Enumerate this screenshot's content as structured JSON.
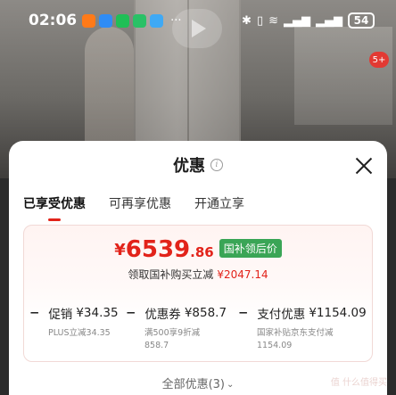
{
  "status_bar": {
    "time": "02:06",
    "more_indicator": "···",
    "battery": "54",
    "app_icons": [
      "taobao-icon",
      "blue-arrow-icon",
      "wechat-icon",
      "wechat-icon",
      "qq-icon"
    ],
    "system_icons": [
      "bluetooth-icon",
      "vibrate-icon",
      "wifi-icon",
      "signal-icon",
      "signal-icon"
    ]
  },
  "background": {
    "notification_badge": "5+"
  },
  "sheet": {
    "title": "优惠",
    "tabs": [
      {
        "label": "已享受优惠",
        "active": true
      },
      {
        "label": "可再享优惠",
        "active": false
      },
      {
        "label": "开通立享",
        "active": false
      }
    ],
    "price": {
      "currency": "¥",
      "integer": "6539",
      "decimal": ".86",
      "tag": "国补领后价"
    },
    "subsidy": {
      "label": "领取国补购买立减",
      "amount": "¥2047.14"
    },
    "breakdown": [
      {
        "label": "促销",
        "value": "¥34.35",
        "detail": [
          "PLUS立减34.35"
        ]
      },
      {
        "label": "优惠券",
        "value": "¥858.7",
        "detail": [
          "满500享9折减",
          "858.7"
        ]
      },
      {
        "label": "支付优惠",
        "value": "¥1154.09",
        "detail": [
          "国家补贴京东支付减",
          "1154.09"
        ]
      }
    ],
    "all_offers": "全部优惠(3)",
    "watermark": "值 什么值得买"
  },
  "colors": {
    "accent_red": "#e2231a",
    "tag_green": "#3aa556"
  }
}
